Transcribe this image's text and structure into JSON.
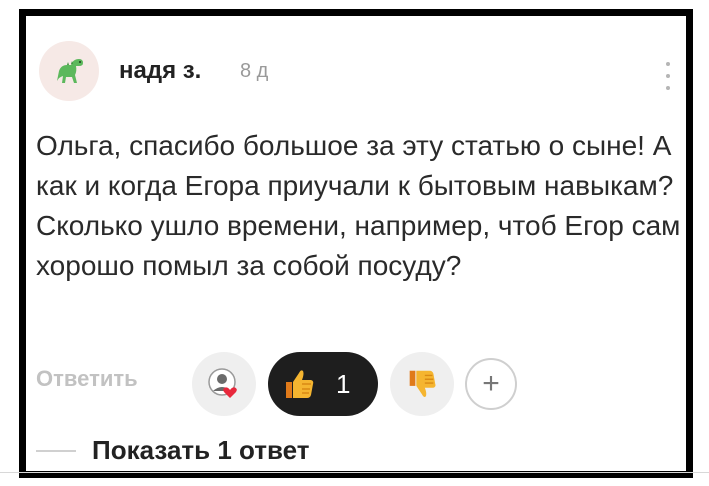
{
  "comment": {
    "author": "надя з.",
    "time_ago": "8 д",
    "text": "Ольга, спасибо большое за эту статью о сыне! А как и когда Егора приучали к бытовым навыкам? Сколько ушло времени, например, чтоб Егор сам хорошо помыл за собой посуду?",
    "avatar_icon": "dinosaur-icon"
  },
  "actions": {
    "reply_label": "Ответить",
    "reactor_icon": "user-heart-icon",
    "like_icon": "thumbs-up-icon",
    "like_count": "1",
    "dislike_icon": "thumbs-down-icon",
    "add_reaction_label": "+"
  },
  "replies": {
    "show_label": "Показать 1 ответ"
  },
  "colors": {
    "like_pill_bg": "#1e1e1e",
    "muted_text": "#c2c2c2",
    "frame_border": "#000000"
  }
}
